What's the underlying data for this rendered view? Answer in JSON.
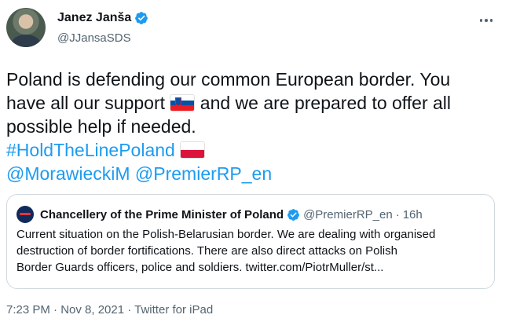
{
  "author": {
    "display_name": "Janez Janša",
    "handle": "@JJansaSDS",
    "verified_icon": "verified-badge-icon",
    "avatar": "avatar-photo"
  },
  "more_icon": "more-options-icon",
  "tweet": {
    "line1": "Poland is defending our common European border. You",
    "line2_a": "have all our support",
    "line2_b": "and we are prepared to offer all",
    "line3": "possible help if needed.",
    "hashtag": "#HoldTheLinePoland",
    "mention1": "@MorawieckiM",
    "mention2": "@PremierRP_en",
    "flag_slovenia": "flag-slovenia-icon",
    "flag_poland": "flag-poland-icon"
  },
  "quoted": {
    "display_name": "Chancellery of the Prime Minister of Poland",
    "handle": "@PremierRP_en",
    "separator": "·",
    "time": "16h",
    "line1": "Current situation on the Polish-Belarusian border. We are dealing with organised",
    "line2": "destruction of border fortifications. There are also direct attacks on Polish",
    "line3": "Border Guards officers, police and soldiers. twitter.com/PiotrMuller/st..."
  },
  "meta": {
    "text": "7:23 PM · Nov 8, 2021 · Twitter for iPad"
  },
  "colors": {
    "link": "#1d9bf0",
    "secondary_text": "#536471",
    "primary_text": "#0f1419",
    "border": "#cfd9de"
  }
}
